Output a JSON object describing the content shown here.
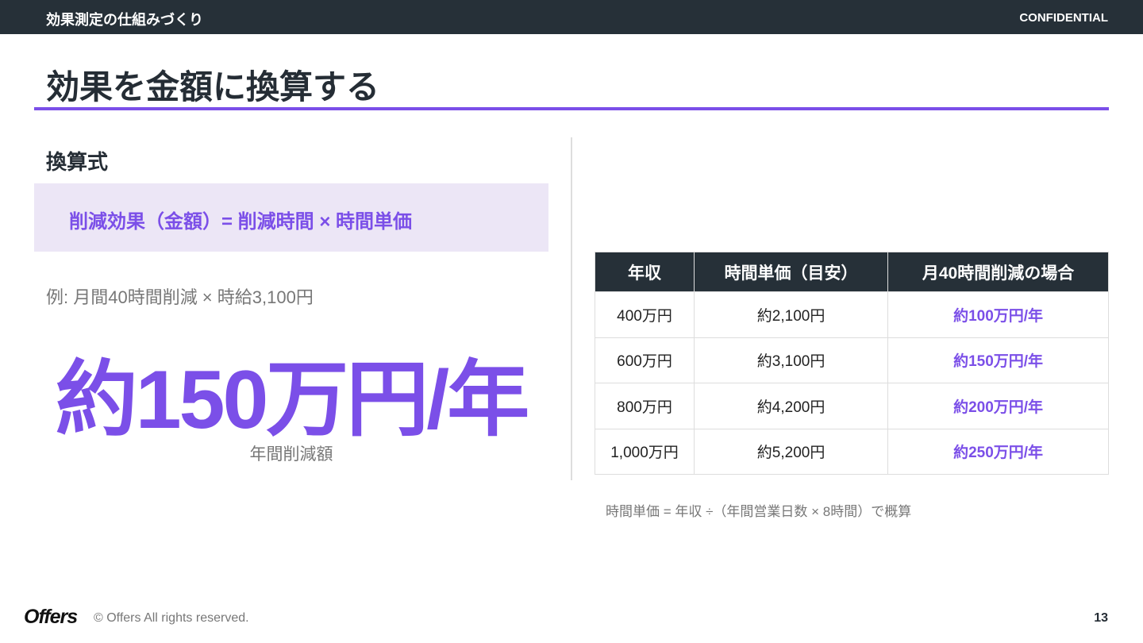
{
  "header": {
    "section": "効果測定の仕組みづくり",
    "confidential": "CONFIDENTIAL"
  },
  "title": "効果を金額に換算する",
  "left": {
    "heading": "換算式",
    "formula": "削減効果（金額）= 削減時間 × 時間単価",
    "example": "例: 月間40時間削減 × 時給3,100円",
    "big_value": "約150万円/年",
    "big_caption": "年間削減額"
  },
  "table": {
    "headers": [
      "年収",
      "時間単価（目安）",
      "月40時間削減の場合"
    ],
    "rows": [
      [
        "400万円",
        "約2,100円",
        "約100万円/年"
      ],
      [
        "600万円",
        "約3,100円",
        "約150万円/年"
      ],
      [
        "800万円",
        "約4,200円",
        "約200万円/年"
      ],
      [
        "1,000万円",
        "約5,200円",
        "約250万円/年"
      ]
    ],
    "note": "時間単価 = 年収 ÷（年間営業日数 × 8時間）で概算"
  },
  "footer": {
    "logo": "Offers",
    "copyright": "© Offers All rights reserved.",
    "page": "13"
  }
}
